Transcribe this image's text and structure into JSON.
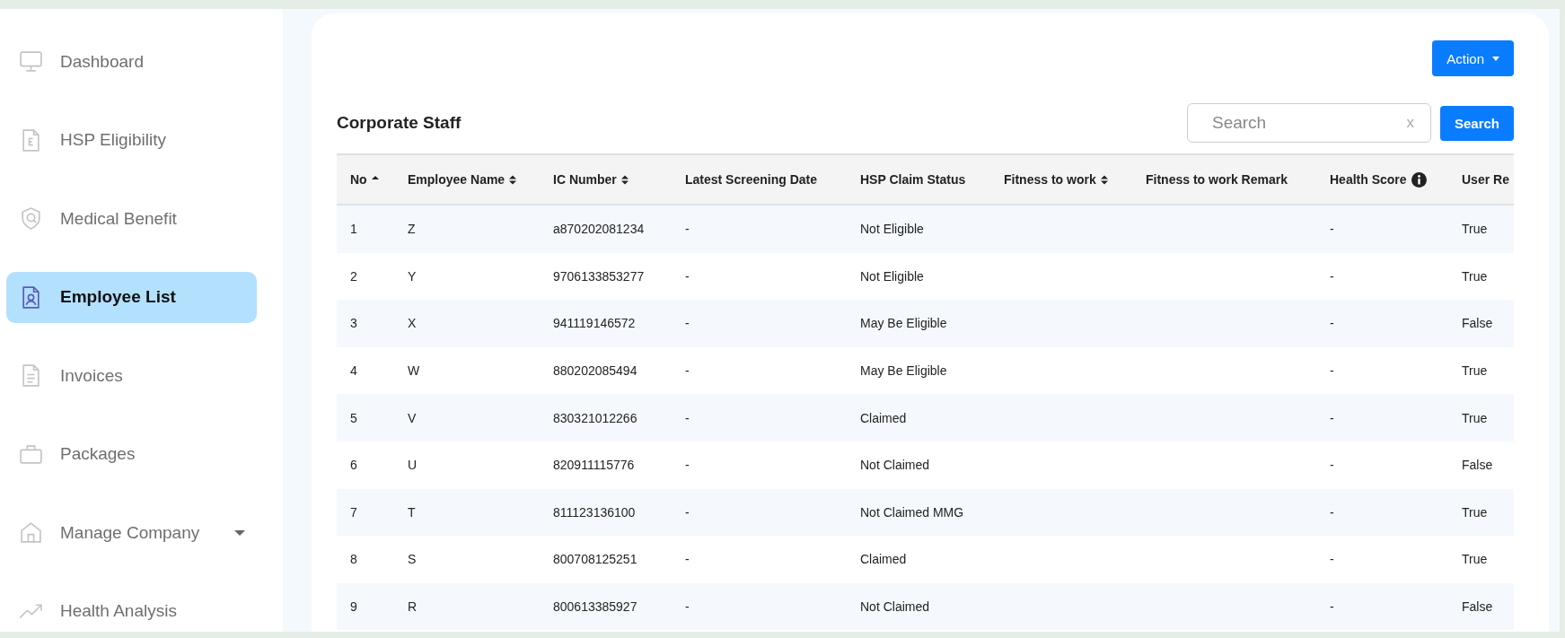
{
  "sidebar": {
    "items": [
      {
        "label": "Dashboard",
        "selected": false
      },
      {
        "label": "HSP Eligibility",
        "selected": false
      },
      {
        "label": "Medical Benefit",
        "selected": false
      },
      {
        "label": "Employee List",
        "selected": true
      },
      {
        "label": "Invoices",
        "selected": false
      },
      {
        "label": "Packages",
        "selected": false
      },
      {
        "label": "Manage Company",
        "selected": false,
        "dropdown": true
      },
      {
        "label": "Health Analysis",
        "selected": false
      }
    ]
  },
  "card": {
    "action_button": "Action",
    "title": "Corporate Staff",
    "search": {
      "placeholder": "Search",
      "clear": "x",
      "button": "Search"
    },
    "table": {
      "columns": [
        {
          "label": "No",
          "kind": "sorted"
        },
        {
          "label": "Employee Name",
          "kind": "sortable"
        },
        {
          "label": "IC Number",
          "kind": "sortable"
        },
        {
          "label": "Latest Screening Date",
          "kind": "plain"
        },
        {
          "label": "HSP Claim Status",
          "kind": "plain"
        },
        {
          "label": "Fitness to work",
          "kind": "sortable"
        },
        {
          "label": "Fitness to work Remark",
          "kind": "plain"
        },
        {
          "label": "Health Score",
          "kind": "plain",
          "info": true
        },
        {
          "label": "User Re",
          "kind": "plain"
        }
      ],
      "rows": [
        {
          "no": "1",
          "name": "Z",
          "ic_number": "a870202081234",
          "screening_date": "-",
          "hsp_claim_status": "Not Eligible",
          "health_score": "-",
          "user_re": "True"
        },
        {
          "no": "2",
          "name": "Y",
          "ic_number": "9706133853277",
          "screening_date": "-",
          "hsp_claim_status": "Not Eligible",
          "health_score": "-",
          "user_re": "True"
        },
        {
          "no": "3",
          "name": "X",
          "ic_number": "941119146572",
          "screening_date": "-",
          "hsp_claim_status": "May Be Eligible",
          "health_score": "-",
          "user_re": "False"
        },
        {
          "no": "4",
          "name": "W",
          "ic_number": "880202085494",
          "screening_date": "-",
          "hsp_claim_status": "May Be Eligible",
          "health_score": "-",
          "user_re": "True"
        },
        {
          "no": "5",
          "name": "V",
          "ic_number": "830321012266",
          "screening_date": "-",
          "hsp_claim_status": "Claimed",
          "health_score": "-",
          "user_re": "True"
        },
        {
          "no": "6",
          "name": "U",
          "ic_number": "820911115776",
          "screening_date": "-",
          "hsp_claim_status": "Not Claimed",
          "health_score": "-",
          "user_re": "False"
        },
        {
          "no": "7",
          "name": "T",
          "ic_number": "811123136100",
          "screening_date": "-",
          "hsp_claim_status": "Not Claimed MMG",
          "health_score": "-",
          "user_re": "True"
        },
        {
          "no": "8",
          "name": "S",
          "ic_number": "800708125251",
          "screening_date": "-",
          "hsp_claim_status": "Claimed",
          "health_score": "-",
          "user_re": "True"
        },
        {
          "no": "9",
          "name": "R",
          "ic_number": "800613385927",
          "screening_date": "-",
          "hsp_claim_status": "Not Claimed",
          "health_score": "-",
          "user_re": "False"
        }
      ]
    }
  }
}
